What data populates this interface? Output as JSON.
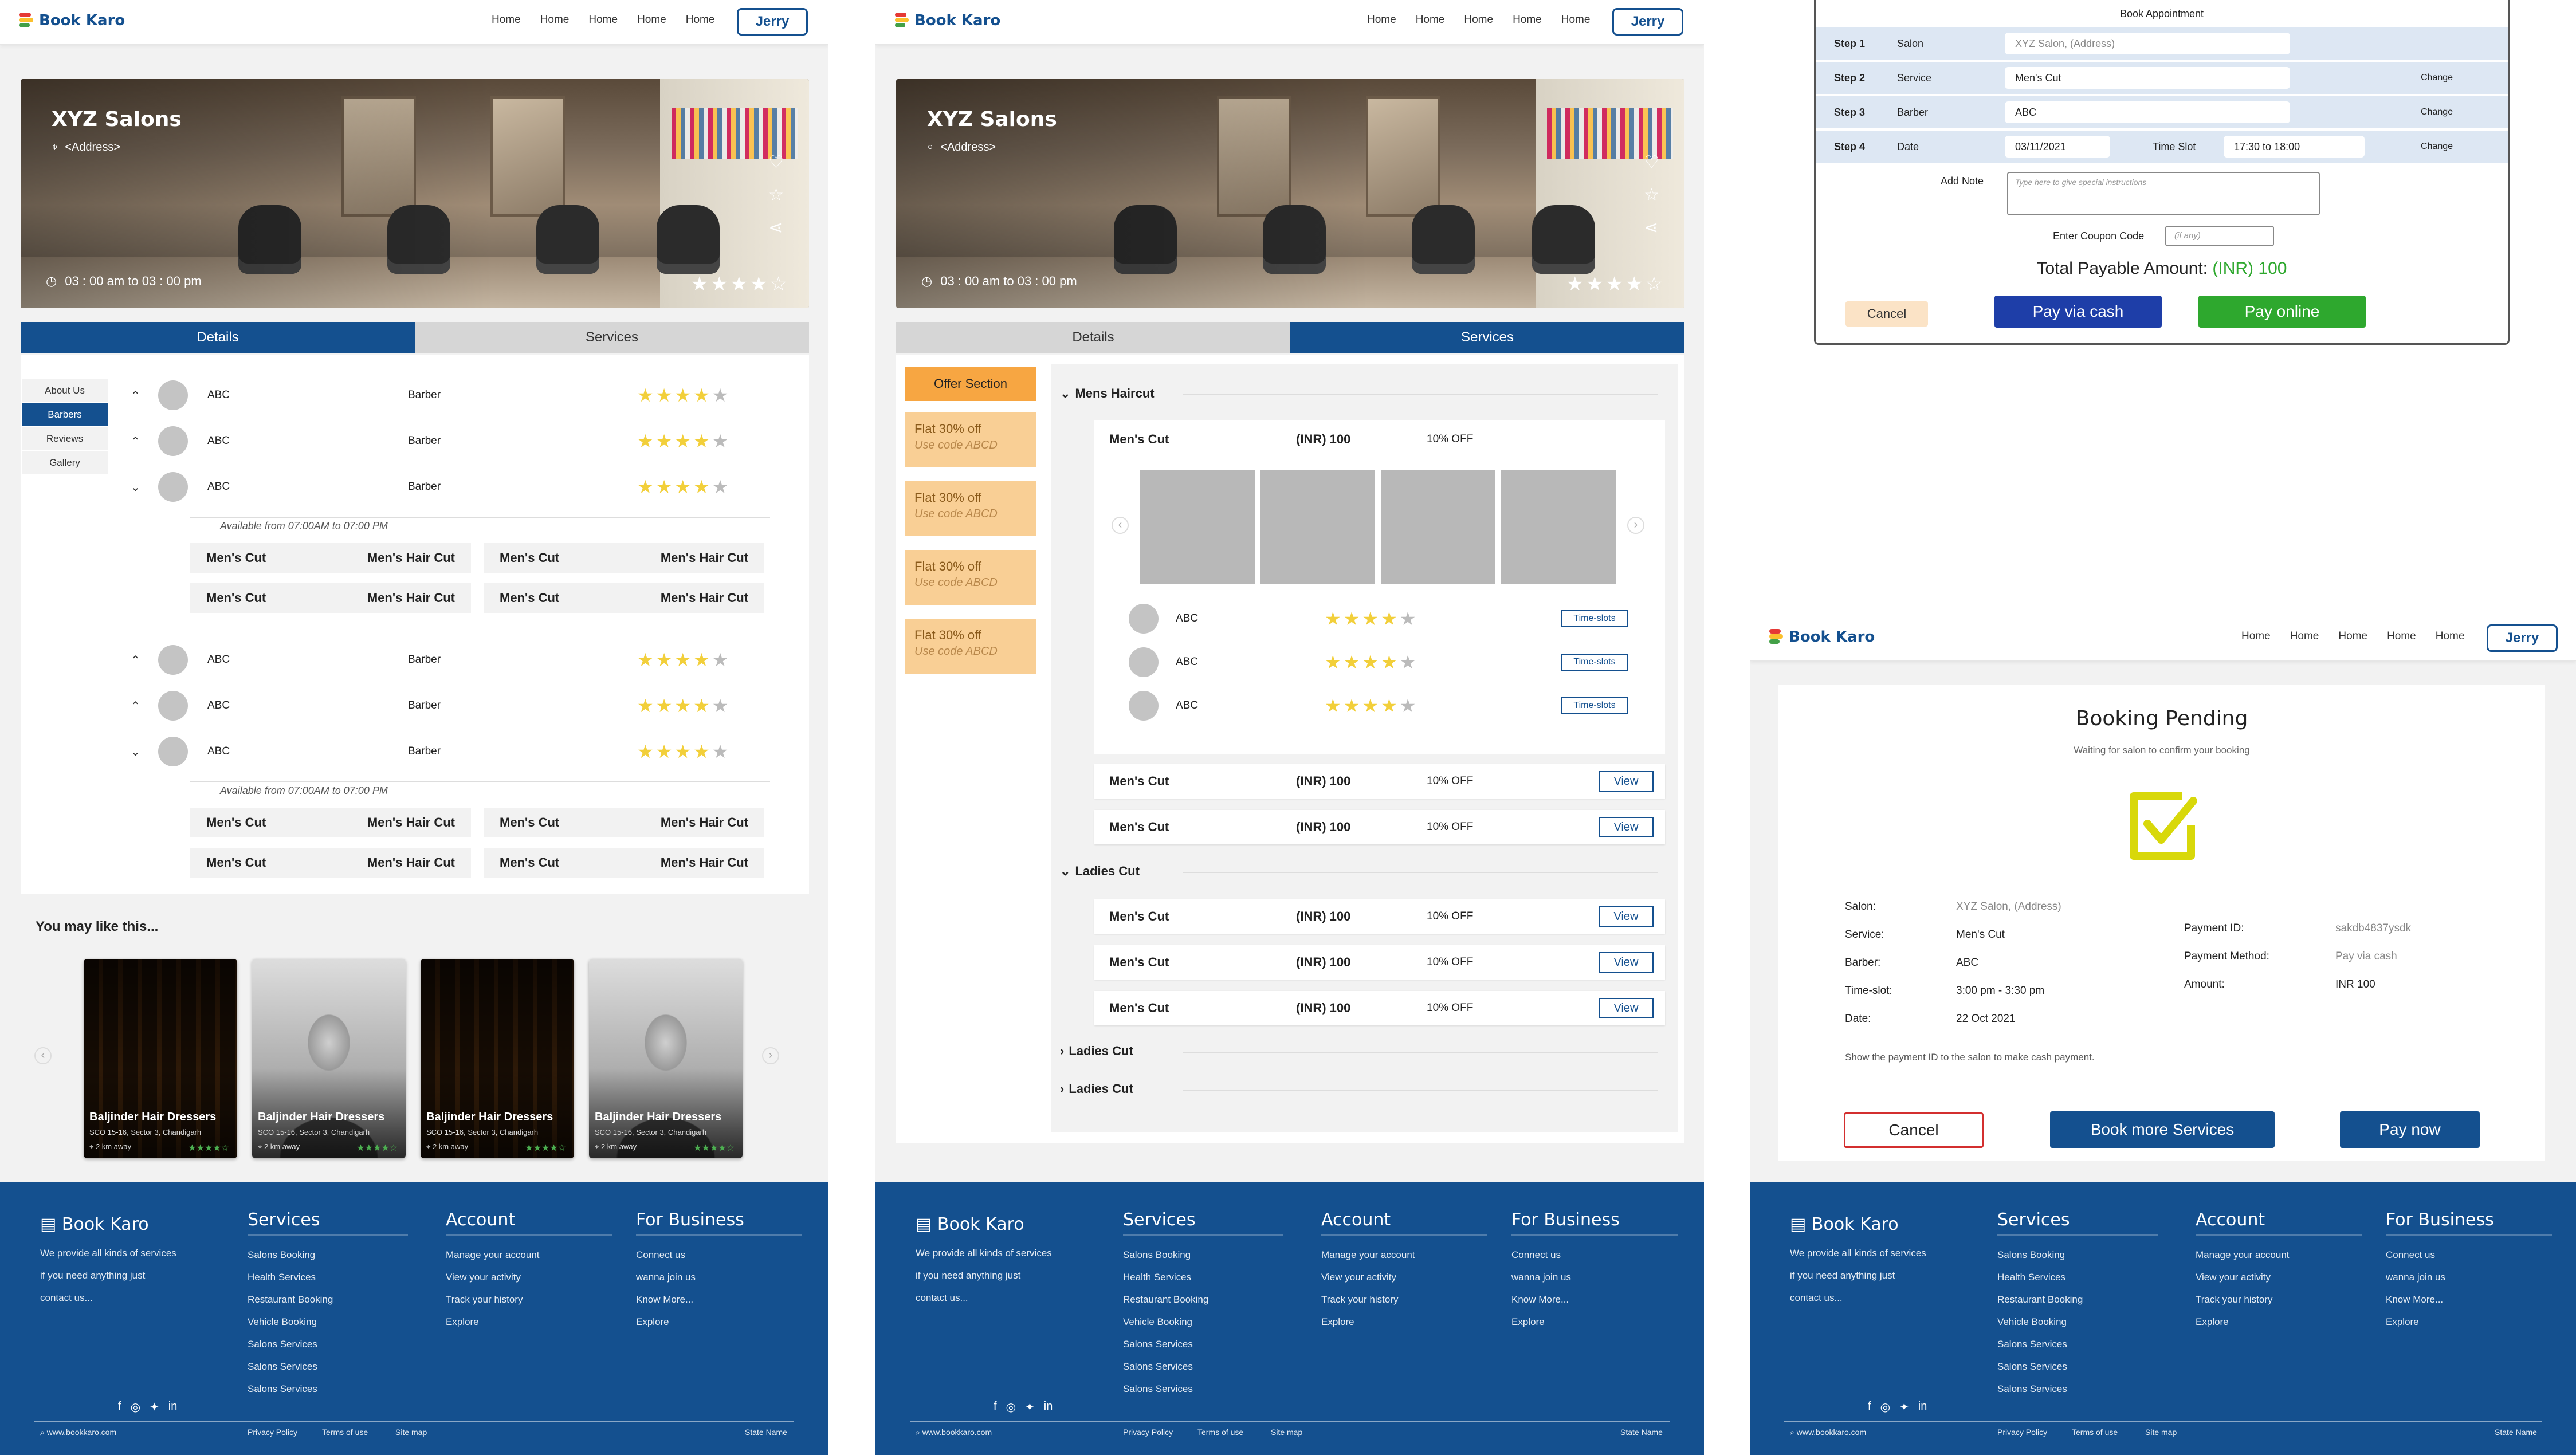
{
  "brand": "Book Karo",
  "nav": {
    "links": [
      "Home",
      "Home",
      "Home",
      "Home",
      "Home"
    ],
    "user": "Jerry"
  },
  "salon": {
    "name": "XYZ Salons",
    "address": "<Address>",
    "hours": "03 : 00 am to 03 : 00 pm"
  },
  "tabs": {
    "details": "Details",
    "services": "Services"
  },
  "side_menu": [
    "About Us",
    "Barbers",
    "Reviews",
    "Gallery"
  ],
  "barber_groups": [
    {
      "rows": [
        {
          "name": "ABC",
          "role": "Barber",
          "chev": "up"
        },
        {
          "name": "ABC",
          "role": "Barber",
          "chev": "up"
        },
        {
          "name": "ABC",
          "role": "Barber",
          "chev": "down"
        }
      ],
      "available": "Available from 07:00AM to 07:00 PM",
      "services": [
        [
          "Men's Cut",
          "Men's Hair Cut",
          "Men's Cut",
          "Men's Hair Cut"
        ],
        [
          "Men's Cut",
          "Men's Hair Cut",
          "Men's Cut",
          "Men's Hair Cut"
        ]
      ]
    },
    {
      "rows": [
        {
          "name": "ABC",
          "role": "Barber",
          "chev": "up"
        },
        {
          "name": "ABC",
          "role": "Barber",
          "chev": "up"
        },
        {
          "name": "ABC",
          "role": "Barber",
          "chev": "down"
        }
      ],
      "available": "Available from 07:00AM to 07:00 PM",
      "services": [
        [
          "Men's Cut",
          "Men's Hair Cut",
          "Men's Cut",
          "Men's Hair Cut"
        ],
        [
          "Men's Cut",
          "Men's Hair Cut",
          "Men's Cut",
          "Men's Hair Cut"
        ]
      ]
    }
  ],
  "rating": 4,
  "like_title": "You may like this...",
  "like_cards": [
    {
      "name": "Baljinder Hair Dressers",
      "addr": "SCO 15-16, Sector 3, Chandigarh",
      "dist": "2 km away",
      "kind": "salon"
    },
    {
      "name": "Baljinder Hair Dressers",
      "addr": "SCO 15-16, Sector 3, Chandigarh",
      "dist": "2 km away",
      "kind": "man"
    },
    {
      "name": "Baljinder Hair Dressers",
      "addr": "SCO 15-16, Sector 3, Chandigarh",
      "dist": "2 km away",
      "kind": "salon"
    },
    {
      "name": "Baljinder Hair Dressers",
      "addr": "SCO 15-16, Sector 3, Chandigarh",
      "dist": "2 km away",
      "kind": "man"
    }
  ],
  "offers": {
    "header": "Offer Section",
    "items": [
      {
        "title": "Flat 30% off",
        "code": "Use code ABCD"
      },
      {
        "title": "Flat 30% off",
        "code": "Use code ABCD"
      },
      {
        "title": "Flat 30% off",
        "code": "Use code ABCD"
      },
      {
        "title": "Flat 30% off",
        "code": "Use code ABCD"
      }
    ]
  },
  "services_list": {
    "mens_header": "Mens Haircut",
    "expanded": {
      "name": "Men's Cut",
      "price": "(INR) 100",
      "discount": "10% OFF",
      "barbers": [
        {
          "name": "ABC",
          "btn": "Time-slots"
        },
        {
          "name": "ABC",
          "btn": "Time-slots"
        },
        {
          "name": "ABC",
          "btn": "Time-slots"
        }
      ]
    },
    "mens_rows": [
      {
        "name": "Men's Cut",
        "price": "(INR) 100",
        "discount": "10% OFF",
        "btn": "View"
      },
      {
        "name": "Men's Cut",
        "price": "(INR) 100",
        "discount": "10% OFF",
        "btn": "View"
      }
    ],
    "ladies_header": "Ladies Cut",
    "ladies_rows": [
      {
        "name": "Men's Cut",
        "price": "(INR) 100",
        "discount": "10% OFF",
        "btn": "View"
      },
      {
        "name": "Men's Cut",
        "price": "(INR) 100",
        "discount": "10% OFF",
        "btn": "View"
      },
      {
        "name": "Men's Cut",
        "price": "(INR) 100",
        "discount": "10% OFF",
        "btn": "View"
      }
    ],
    "collapsed": [
      "Ladies Cut",
      "Ladies Cut"
    ]
  },
  "booking": {
    "title": "Book Appointment",
    "steps": [
      {
        "step": "Step 1",
        "label": "Salon",
        "value": "XYZ Salon, (Address)",
        "value2": "",
        "label2": "",
        "change": ""
      },
      {
        "step": "Step 2",
        "label": "Service",
        "value": "Men's Cut",
        "value2": "",
        "label2": "",
        "change": "Change"
      },
      {
        "step": "Step 3",
        "label": "Barber",
        "value": "ABC",
        "value2": "",
        "label2": "",
        "change": "Change"
      },
      {
        "step": "Step 4",
        "label": "Date",
        "value": "03/11/2021",
        "label2": "Time Slot",
        "value2": "17:30 to 18:00",
        "change": "Change"
      }
    ],
    "note_label": "Add Note",
    "note_placeholder": "Type here to give special instructions",
    "coupon_label": "Enter Coupon Code",
    "coupon_placeholder": "(if any)",
    "total_label": "Total Payable Amount:",
    "total_value": "(INR) 100",
    "cancel": "Cancel",
    "pay_cash": "Pay via cash",
    "pay_online": "Pay online"
  },
  "pending": {
    "title": "Booking Pending",
    "subtitle": "Waiting for salon to confirm your booking",
    "left": [
      [
        "Salon:",
        "XYZ Salon, (Address)"
      ],
      [
        "Service:",
        "Men's Cut"
      ],
      [
        "Barber:",
        "ABC"
      ],
      [
        "Time-slot:",
        "3:00 pm - 3:30 pm"
      ],
      [
        "Date:",
        "22 Oct 2021"
      ]
    ],
    "right": [
      [
        "Payment ID:",
        "sakdb4837ysdk"
      ],
      [
        "Payment Method:",
        "Pay via cash"
      ],
      [
        "Amount:",
        "INR 100"
      ]
    ],
    "note": "Show the payment ID to the salon to make cash payment.",
    "cancel": "Cancel",
    "more": "Book more Services",
    "pay": "Pay now"
  },
  "footer": {
    "brand": "Book Karo",
    "desc": [
      "We provide all kinds of services",
      "if you need anything just",
      "contact us..."
    ],
    "services": {
      "title": "Services",
      "items": [
        "Salons Booking",
        "Health Services",
        "Restaurant Booking",
        "Vehicle Booking",
        "Salons Services",
        "Salons Services",
        "Salons Services"
      ]
    },
    "account": {
      "title": "Account",
      "items": [
        "Manage your account",
        "View your activity",
        "Track your history",
        "Explore"
      ]
    },
    "business": {
      "title": "For Business",
      "items": [
        "Connect us",
        "wanna join us",
        "Know More...",
        "Explore"
      ]
    },
    "site": "www.bookkaro.com",
    "links": [
      "Privacy Policy",
      "Terms of use",
      "Site map"
    ],
    "state": "State Name"
  },
  "colors": {
    "primary": "#14508f",
    "offer": "#f9cf95",
    "star": "#f2cf3a",
    "green": "#2ea82e",
    "highlight": "#dde7f3",
    "check": "#d8d80a",
    "cancel_bg": "#fbe3c6"
  }
}
